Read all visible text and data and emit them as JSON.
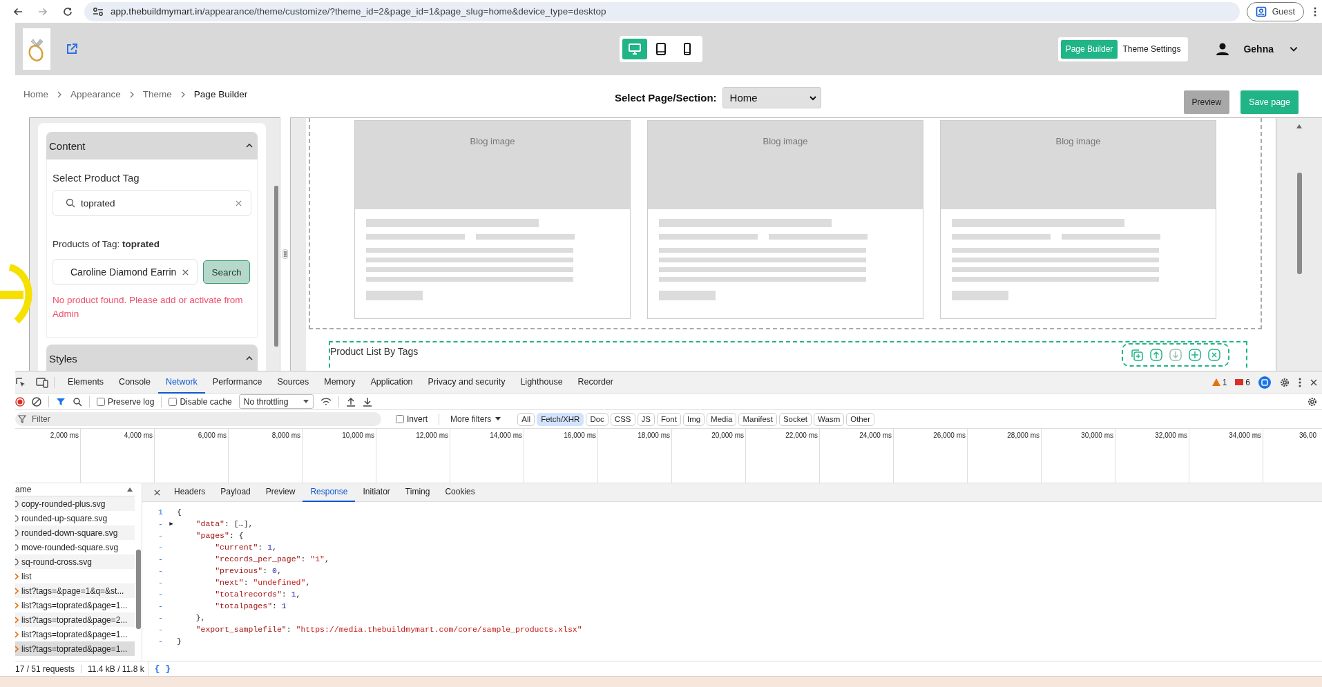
{
  "browser": {
    "host": "app.thebuildmymart.in",
    "path": "/appearance/theme/customize/?theme_id=2&page_id=1&page_slug=home&device_type=desktop",
    "profile": "Guest"
  },
  "header": {
    "devices": [
      {
        "kind": "desktop",
        "selected": true
      },
      {
        "kind": "tablet",
        "selected": false
      },
      {
        "kind": "mobile",
        "selected": false
      }
    ],
    "tabs": [
      {
        "label": "Page Builder",
        "selected": true
      },
      {
        "label": "Theme Settings",
        "selected": false
      }
    ],
    "user": "Gehna"
  },
  "breadcrumb": [
    "Home",
    "Appearance",
    "Theme",
    "Page Builder"
  ],
  "page_select": {
    "label": "Select Page/Section:",
    "value": "Home"
  },
  "actions": [
    {
      "label": "Preview",
      "kind": "secondary"
    },
    {
      "label": "Save page",
      "kind": "primary"
    }
  ],
  "sidebar": {
    "sections": [
      {
        "title": "Content",
        "expanded": true
      },
      {
        "title": "Styles",
        "expanded": true
      }
    ],
    "tag_label": "Select Product Tag",
    "tag_value": "toprated",
    "products_label": "Products of Tag: **toprated**",
    "product_value": "Caroline Diamond Earrin",
    "search_button": "Search",
    "error": "No product found. Please add or activate from Admin"
  },
  "canvas": {
    "blog_cards": [
      {
        "image_label": "Blog image"
      },
      {
        "image_label": "Blog image"
      },
      {
        "image_label": "Blog image"
      }
    ],
    "section_label": "Product List By Tags"
  },
  "devtools": {
    "tabs": [
      {
        "label": "Elements",
        "selected": false
      },
      {
        "label": "Console",
        "selected": false
      },
      {
        "label": "Network",
        "selected": true
      },
      {
        "label": "Performance",
        "selected": false
      },
      {
        "label": "Sources",
        "selected": false
      },
      {
        "label": "Memory",
        "selected": false
      },
      {
        "label": "Application",
        "selected": false
      },
      {
        "label": "Privacy and security",
        "selected": false
      },
      {
        "label": "Lighthouse",
        "selected": false
      },
      {
        "label": "Recorder",
        "selected": false
      }
    ],
    "warnings": "1",
    "errors": "6",
    "preserve_log": {
      "label": "Preserve log",
      "checked": false
    },
    "disable_cache": {
      "label": "Disable cache",
      "checked": false
    },
    "throttling": "No throttling",
    "filter_placeholder": "Filter",
    "invert": {
      "label": "Invert",
      "checked": false
    },
    "more_filters": "More filters",
    "type_filters": [
      {
        "label": "All",
        "selected": false
      },
      {
        "label": "Fetch/XHR",
        "selected": true
      },
      {
        "label": "Doc",
        "selected": false
      },
      {
        "label": "CSS",
        "selected": false
      },
      {
        "label": "JS",
        "selected": false
      },
      {
        "label": "Font",
        "selected": false
      },
      {
        "label": "Img",
        "selected": false
      },
      {
        "label": "Media",
        "selected": false
      },
      {
        "label": "Manifest",
        "selected": false
      },
      {
        "label": "Socket",
        "selected": false
      },
      {
        "label": "Wasm",
        "selected": false
      },
      {
        "label": "Other",
        "selected": false
      }
    ],
    "timeline_ticks": [
      "2,000 ms",
      "4,000 ms",
      "6,000 ms",
      "8,000 ms",
      "10,000 ms",
      "12,000 ms",
      "14,000 ms",
      "16,000 ms",
      "18,000 ms",
      "20,000 ms",
      "22,000 ms",
      "24,000 ms",
      "26,000 ms",
      "28,000 ms",
      "30,000 ms",
      "32,000 ms",
      "34,000 ms",
      "36,00"
    ],
    "name_header": "ame",
    "requests": [
      {
        "name": "copy-rounded-plus.svg",
        "kind": "image",
        "selected": false
      },
      {
        "name": "rounded-up-square.svg",
        "kind": "image",
        "selected": false
      },
      {
        "name": "rounded-down-square.svg",
        "kind": "image",
        "selected": false
      },
      {
        "name": "move-rounded-square.svg",
        "kind": "image",
        "selected": false
      },
      {
        "name": "sq-round-cross.svg",
        "kind": "image",
        "selected": false
      },
      {
        "name": "list",
        "kind": "fetch",
        "selected": false
      },
      {
        "name": "list?tags=&page=1&q=&st...",
        "kind": "fetch",
        "selected": false
      },
      {
        "name": "list?tags=toprated&page=1...",
        "kind": "fetch",
        "selected": false
      },
      {
        "name": "list?tags=toprated&page=2...",
        "kind": "fetch",
        "selected": false
      },
      {
        "name": "list?tags=toprated&page=1...",
        "kind": "fetch",
        "selected": false
      },
      {
        "name": "list?tags=toprated&page=1...",
        "kind": "fetch",
        "selected": true
      }
    ],
    "detail_tabs": [
      {
        "label": "Headers",
        "selected": false
      },
      {
        "label": "Payload",
        "selected": false
      },
      {
        "label": "Preview",
        "selected": false
      },
      {
        "label": "Response",
        "selected": true
      },
      {
        "label": "Initiator",
        "selected": false
      },
      {
        "label": "Timing",
        "selected": false
      },
      {
        "label": "Cookies",
        "selected": false
      }
    ],
    "response_lines": [
      {
        "gutter": "1",
        "text": "{"
      },
      {
        "gutter": "-",
        "marker": "▶",
        "text": "    \"data\": […],"
      },
      {
        "gutter": "-",
        "text": "    \"pages\": {"
      },
      {
        "gutter": "-",
        "text": "        \"current\": 1,"
      },
      {
        "gutter": "-",
        "text": "        \"records_per_page\": \"1\","
      },
      {
        "gutter": "-",
        "text": "        \"previous\": 0,"
      },
      {
        "gutter": "-",
        "text": "        \"next\": \"undefined\","
      },
      {
        "gutter": "-",
        "text": "        \"totalrecords\": 1,"
      },
      {
        "gutter": "-",
        "text": "        \"totalpages\": 1"
      },
      {
        "gutter": "-",
        "text": "    },"
      },
      {
        "gutter": "-",
        "text": "    \"export_samplefile\": \"https://media.thebuildmymart.com/core/sample_products.xlsx\""
      },
      {
        "gutter": "-",
        "text": "}"
      }
    ],
    "status": {
      "requests": "17 / 51 requests",
      "transfer": "11.4 kB / 11.8 k",
      "pretty_print": "{ }"
    }
  }
}
